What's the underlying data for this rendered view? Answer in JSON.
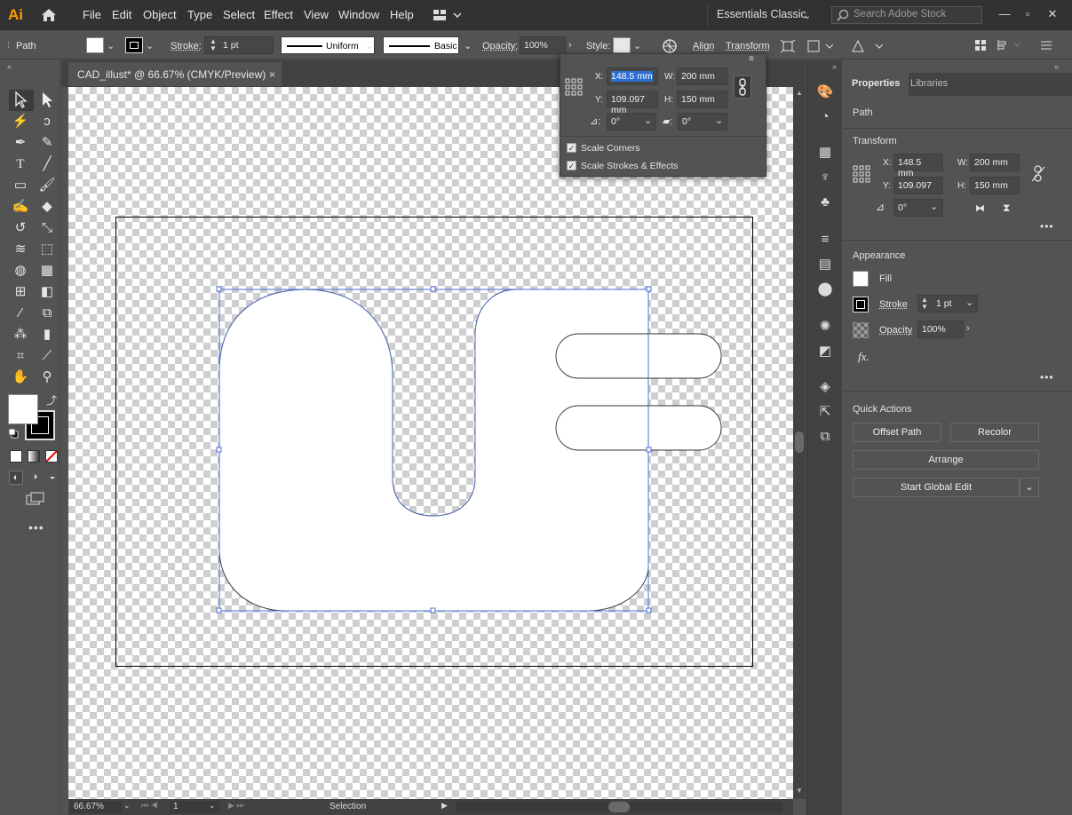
{
  "app": {
    "logo": "Ai",
    "workspace": "Essentials Classic",
    "stock_search_placeholder": "Search Adobe Stock"
  },
  "menu": [
    "File",
    "Edit",
    "Object",
    "Type",
    "Select",
    "Effect",
    "View",
    "Window",
    "Help"
  ],
  "control_bar": {
    "selection_type": "Path",
    "stroke_label": "Stroke:",
    "stroke_weight": "1 pt",
    "profile": "Uniform",
    "brush": "Basic",
    "opacity_label": "Opacity:",
    "opacity_value": "100%",
    "style_label": "Style:",
    "align_label": "Align",
    "transform_label": "Transform"
  },
  "document_tab": {
    "title": "CAD_illust* @ 66.67% (CMYK/Preview)",
    "close": "×"
  },
  "transform_popup": {
    "x_label": "X:",
    "x_value": "148.5 mm",
    "y_label": "Y:",
    "y_value": "109.097 mm",
    "w_label": "W:",
    "w_value": "200 mm",
    "h_label": "H:",
    "h_value": "150 mm",
    "rotate_value": "0°",
    "shear_value": "0°",
    "scale_corners_label": "Scale Corners",
    "scale_corners_checked": true,
    "scale_strokes_label": "Scale Strokes & Effects",
    "scale_strokes_checked": true
  },
  "properties_panel": {
    "tabs": [
      "Properties",
      "Libraries"
    ],
    "selection": "Path",
    "transform_title": "Transform",
    "x_label": "X:",
    "x_value": "148.5 mm",
    "y_label": "Y:",
    "y_value": "109.097 mr",
    "w_label": "W:",
    "w_value": "200 mm",
    "h_label": "H:",
    "h_value": "150 mm",
    "rotate_value": "0°",
    "appearance_title": "Appearance",
    "fill_label": "Fill",
    "stroke_label": "Stroke",
    "stroke_value": "1 pt",
    "opacity_label": "Opacity",
    "opacity_value": "100%",
    "fx_label": "fx.",
    "quick_actions_title": "Quick Actions",
    "offset_path": "Offset Path",
    "recolor": "Recolor",
    "arrange": "Arrange",
    "start_global_edit": "Start Global Edit"
  },
  "status_bar": {
    "zoom": "66.67%",
    "artboard": "1",
    "tool": "Selection"
  },
  "colors": {
    "selection_blue": "#4a6fd8",
    "accent_orange": "#ff9a00",
    "panel_bg": "#535353",
    "dark_bg": "#323232"
  }
}
